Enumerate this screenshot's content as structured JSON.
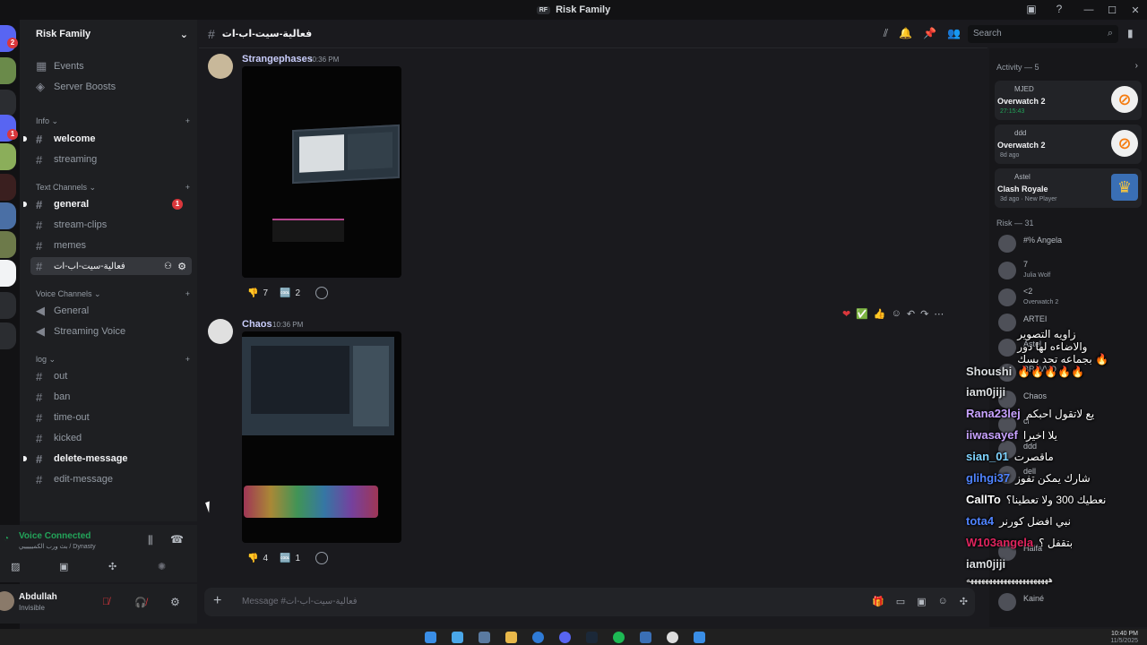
{
  "window": {
    "title": "Risk Family",
    "logo_text": "RF"
  },
  "server": {
    "name": "Risk Family",
    "top_items": [
      {
        "icon": "calendar-icon",
        "label": "Events"
      },
      {
        "icon": "boost-icon",
        "label": "Server Boosts"
      }
    ],
    "categories": [
      {
        "name": "Info",
        "channels": [
          {
            "label": "welcome",
            "type": "text",
            "unread": true
          },
          {
            "label": "streaming",
            "type": "text",
            "unread": false
          }
        ]
      },
      {
        "name": "Text Channels",
        "channels": [
          {
            "label": "general",
            "type": "text",
            "unread": true,
            "mentions": "1"
          },
          {
            "label": "stream-clips",
            "type": "text",
            "unread": false
          },
          {
            "label": "memes",
            "type": "text",
            "unread": false
          },
          {
            "label": "فعالية-سيت-اب-ات",
            "type": "text",
            "unread": false,
            "active": true
          }
        ]
      },
      {
        "name": "Voice Channels",
        "channels": [
          {
            "label": "General",
            "type": "voice"
          },
          {
            "label": "Streaming Voice",
            "type": "voice"
          }
        ]
      },
      {
        "name": "log",
        "channels": [
          {
            "label": "out",
            "type": "text"
          },
          {
            "label": "ban",
            "type": "text"
          },
          {
            "label": "time-out",
            "type": "text"
          },
          {
            "label": "kicked",
            "type": "text"
          },
          {
            "label": "delete-message",
            "type": "text",
            "unread": true
          },
          {
            "label": "edit-message",
            "type": "text"
          }
        ]
      }
    ],
    "rail_badges": [
      "2",
      "1"
    ]
  },
  "voice": {
    "status": "Voice Connected",
    "location": "بث ورب الكميييييي / Dynasty"
  },
  "user": {
    "name": "Abdullah",
    "status": "Invisible"
  },
  "channel": {
    "name": "فعالية-سيت-اب-ات",
    "search_placeholder": "Search",
    "composer_placeholder": "Message #فعالية-سيت-اب-ات"
  },
  "messages": [
    {
      "author": "Strangephases",
      "time": "10:36 PM",
      "reactions": [
        {
          "emoji": "👎",
          "count": "7"
        },
        {
          "emoji": "🆒",
          "count": "2"
        }
      ]
    },
    {
      "author": "Chaos",
      "time": "10:36 PM",
      "reactions": [
        {
          "emoji": "👎",
          "count": "4"
        },
        {
          "emoji": "🆒",
          "count": "1"
        }
      ]
    }
  ],
  "activity": {
    "header": "Activity — 5",
    "cards": [
      {
        "user": "MJED",
        "game": "Overwatch 2",
        "time": "27:15:43",
        "icon": "overwatch-icon"
      },
      {
        "user": "ddd",
        "game": "Overwatch 2",
        "time": "8d ago",
        "icon": "overwatch-icon"
      },
      {
        "user": "Astel",
        "game": "Clash Royale",
        "time": "3d ago",
        "extra": "New Player",
        "icon": "clash-royale-icon"
      }
    ]
  },
  "members": {
    "header": "Risk — 31",
    "list": [
      {
        "name": "#% Angela",
        "sub": ""
      },
      {
        "name": "7",
        "sub": "Julia Wolf"
      },
      {
        "name": "<2",
        "sub": "Overwatch 2"
      },
      {
        "name": "ARTEI",
        "sub": ""
      },
      {
        "name": "Astel",
        "sub": ""
      },
      {
        "name": "BRAVVO",
        "sub": ""
      },
      {
        "name": "Chaos",
        "sub": ""
      },
      {
        "name": "cl",
        "sub": ""
      },
      {
        "name": "ddd",
        "sub": ""
      },
      {
        "name": "dell",
        "sub": ""
      },
      {
        "name": "Haifa",
        "sub": ""
      },
      {
        "name": "Kainé",
        "sub": ""
      }
    ]
  },
  "overlay_chat": [
    {
      "who": "Shoushi",
      "color": "#ffffff",
      "text": "زاويه التصوير والاضاءه لها دور بجماعه تحد بسك 🔥🔥🔥🔥🔥🔥"
    },
    {
      "who": "iam0jiji",
      "color": "#ffffff",
      "text": ""
    },
    {
      "who": "Rana23lej",
      "color": "#c8a2ff",
      "text": "يع لاتقول احبكم"
    },
    {
      "who": "iiwasayef",
      "color": "#c8a2ff",
      "text": "يلا اخيرا"
    },
    {
      "who": "sian_01",
      "color": "#7fd4ff",
      "text": "ماقصرت"
    },
    {
      "who": "glihgi37",
      "color": "#4f83ff",
      "text": "شارك يمكن تفوز"
    },
    {
      "who": "CallTo",
      "color": "#ffffff",
      "text": "نعطيك 300 ولا تعطينا؟"
    },
    {
      "who": "tota4",
      "color": "#4f83ff",
      "text": "نبي افضل كورنر"
    },
    {
      "who": "W103angela",
      "color": "#e0245e",
      "text": "بتقفل ؟"
    },
    {
      "who": "iam0jiji",
      "color": "#ffffff",
      "text": ""
    },
    {
      "who": "",
      "color": "#ffffff",
      "text": "ههههههههههههههههههههههه"
    }
  ],
  "taskbar": {
    "time": "10:40 PM",
    "date": "11/5/2025"
  },
  "colors": {
    "accent": "#5865f2",
    "online": "#23a55a",
    "danger": "#da373c"
  }
}
